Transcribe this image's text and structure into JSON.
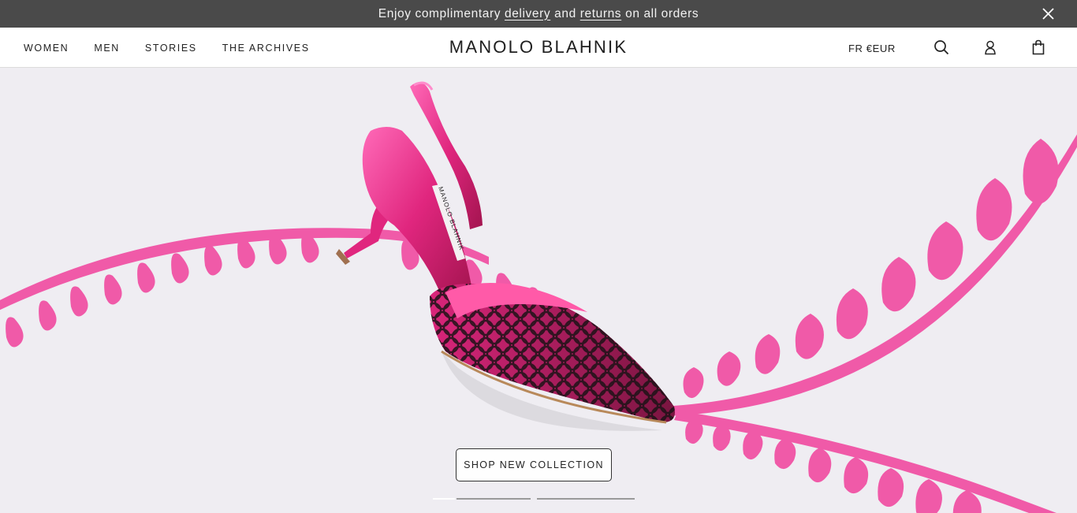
{
  "promo": {
    "text_before": "Enjoy complimentary",
    "link1": "delivery",
    "text_middle": "and",
    "link2": "returns",
    "text_after": "on all orders",
    "close_icon": "close-icon"
  },
  "header": {
    "nav": [
      "WOMEN",
      "MEN",
      "STORIES",
      "THE ARCHIVES"
    ],
    "brand": "MANOLO BLAHNIK",
    "locale": "FR €EUR",
    "icons": [
      "search-icon",
      "account-icon",
      "bag-icon"
    ]
  },
  "hero": {
    "shoe_label": "MANOLO BLAHNIK",
    "cta": "SHOP NEW COLLECTION",
    "slides": [
      {
        "active": true
      },
      {
        "active": false
      },
      {
        "active": false
      }
    ],
    "colors": {
      "background": "#efedf2",
      "accent_pink": "#f05aa8",
      "shoe_pink": "#e0267e",
      "shoe_dark": "#2a1a22"
    }
  }
}
